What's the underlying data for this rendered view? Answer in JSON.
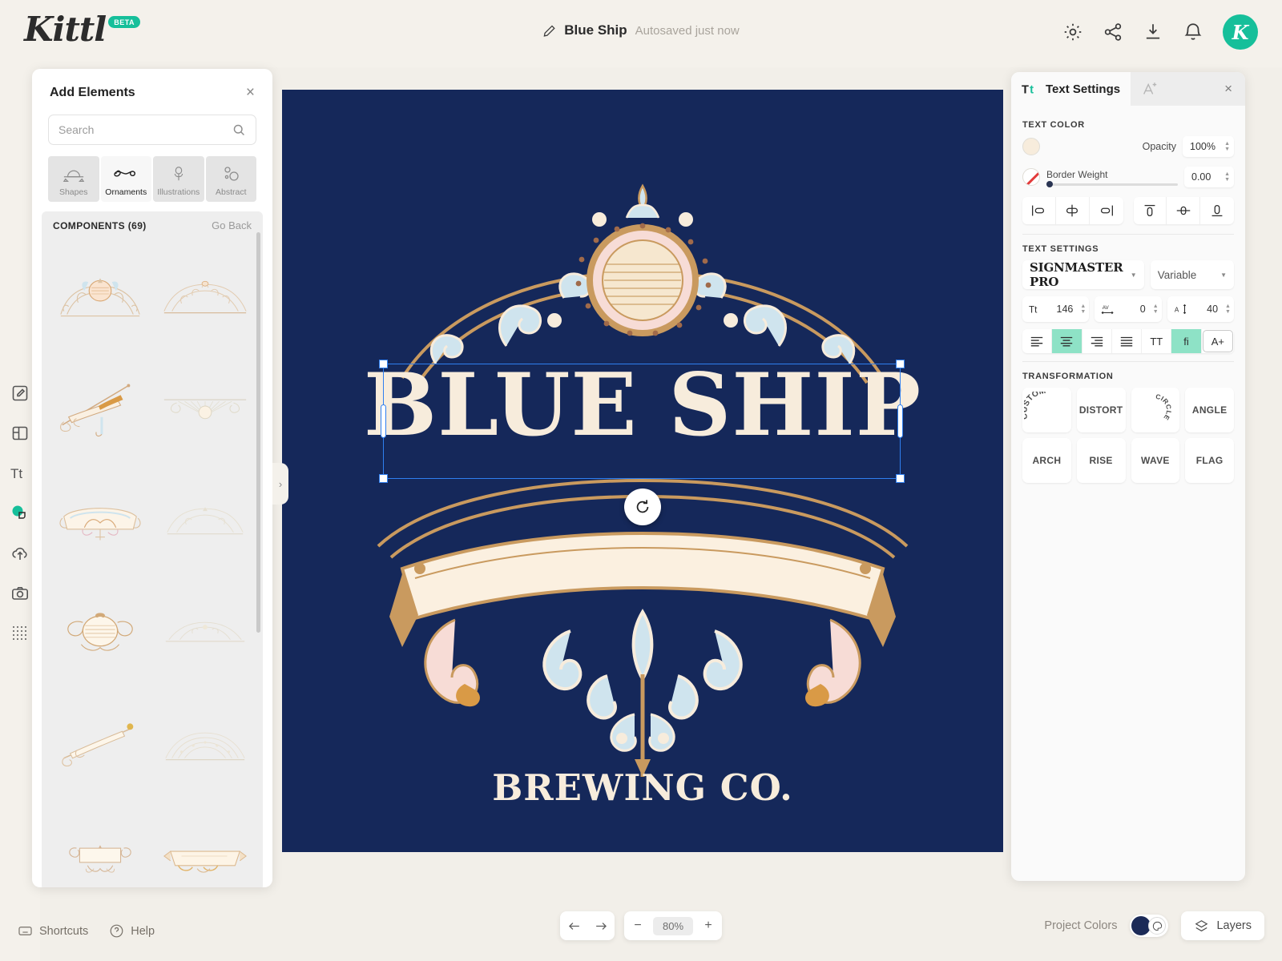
{
  "app": {
    "brand": "Kittl",
    "badge": "BETA",
    "doc_title": "Blue Ship",
    "save_status": "Autosaved just now",
    "avatar_initial": "K",
    "accent": "#16bf9a",
    "canvas_bg": "#15285a",
    "cream": "#f7ecdc"
  },
  "topbar_icons": [
    {
      "name": "settings-icon",
      "label": "Settings"
    },
    {
      "name": "share-icon",
      "label": "Share"
    },
    {
      "name": "download-icon",
      "label": "Download"
    },
    {
      "name": "notifications-icon",
      "label": "Notifications"
    }
  ],
  "left_rail": [
    {
      "name": "design-tool",
      "label": "Design"
    },
    {
      "name": "templates-tool",
      "label": "Templates"
    },
    {
      "name": "text-tool",
      "label": "Text"
    },
    {
      "name": "elements-tool",
      "label": "Elements",
      "active": true
    },
    {
      "name": "uploads-tool",
      "label": "Uploads"
    },
    {
      "name": "photos-tool",
      "label": "Photos"
    },
    {
      "name": "patterns-tool",
      "label": "Patterns"
    }
  ],
  "elements_panel": {
    "title": "Add Elements",
    "close": "×",
    "search": {
      "placeholder": "Search",
      "value": ""
    },
    "tabs": [
      {
        "label": "Shapes",
        "active": false
      },
      {
        "label": "Ornaments",
        "active": true
      },
      {
        "label": "Illustrations",
        "active": false
      },
      {
        "label": "Abstract",
        "active": false
      }
    ],
    "components_header": "COMPONENTS (69)",
    "go_back": "Go Back",
    "component_count": 12
  },
  "canvas": {
    "art_title": "BLUE SHIP",
    "art_subtitle": "BREWING CO."
  },
  "right_panel": {
    "tab_primary": "Text Settings",
    "close": "×",
    "text_color": {
      "section": "TEXT COLOR",
      "swatch": "#f7ecdc",
      "opacity_label": "Opacity",
      "opacity_value": "100%",
      "border_weight_label": "Border Weight",
      "border_weight_value": "0.00"
    },
    "align_buttons": [
      {
        "name": "align-h-left-icon"
      },
      {
        "name": "align-h-center-icon"
      },
      {
        "name": "align-h-right-icon"
      },
      {
        "name": "align-v-top-icon"
      },
      {
        "name": "align-v-middle-icon"
      },
      {
        "name": "align-v-bottom-icon"
      }
    ],
    "text_settings": {
      "section": "TEXT SETTINGS",
      "font_family": "SIGNMASTER PRO",
      "font_variant": "Variable",
      "font_size": "146",
      "letter_spacing": "0",
      "line_height": "40",
      "buttons": [
        {
          "name": "text-align-left",
          "label": "",
          "active": false
        },
        {
          "name": "text-align-center",
          "label": "",
          "active": true
        },
        {
          "name": "text-align-right",
          "label": "",
          "active": false
        },
        {
          "name": "text-align-justify",
          "label": "",
          "active": false
        },
        {
          "name": "uppercase-toggle",
          "label": "TT",
          "active": false
        },
        {
          "name": "ligatures-toggle",
          "label": "fi",
          "active": true
        },
        {
          "name": "more-type-options",
          "label": "A+",
          "active": false
        }
      ]
    },
    "transformation": {
      "section": "TRANSFORMATION",
      "items": [
        {
          "label": "CUSTOM",
          "style": "arc"
        },
        {
          "label": "DISTORT",
          "style": "flat"
        },
        {
          "label": "CIRCLE",
          "style": "circle"
        },
        {
          "label": "ANGLE",
          "style": "flat"
        },
        {
          "label": "ARCH",
          "style": "flat"
        },
        {
          "label": "RISE",
          "style": "flat"
        },
        {
          "label": "WAVE",
          "style": "flat"
        },
        {
          "label": "FLAG",
          "style": "flat"
        }
      ]
    }
  },
  "bottom": {
    "shortcuts": "Shortcuts",
    "help": "Help",
    "zoom_value": "80%",
    "zoom_out": "−",
    "zoom_in": "+",
    "project_colors": "Project Colors",
    "layers": "Layers"
  }
}
